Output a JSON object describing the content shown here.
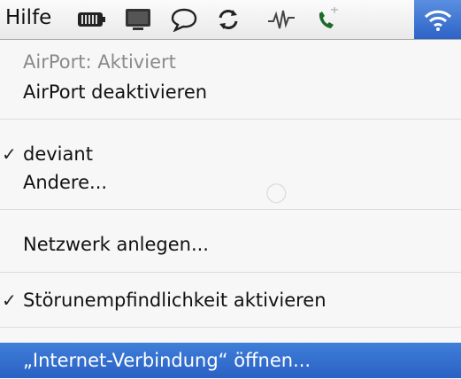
{
  "menubar": {
    "title": "Hilfe",
    "icons": [
      "battery-icon",
      "display-icon",
      "speech-bubble-icon",
      "sync-icon",
      "signal-icon",
      "phone-icon",
      "wifi-icon"
    ]
  },
  "menu": {
    "status": "AirPort: Aktiviert",
    "toggle": "AirPort deaktivieren",
    "networks": [
      {
        "label": "deviant",
        "checked": true
      },
      {
        "label": "Andere...",
        "checked": false
      }
    ],
    "create_network": "Netzwerk anlegen...",
    "interference": {
      "label": "Störunempfindlichkeit aktivieren",
      "checked": true
    },
    "open_internet": "„Internet-Verbindung“ öffnen..."
  },
  "check_glyph": "✓",
  "colors": {
    "highlight": "#2f68cc",
    "active_icon_bg": "#3a72d4"
  }
}
